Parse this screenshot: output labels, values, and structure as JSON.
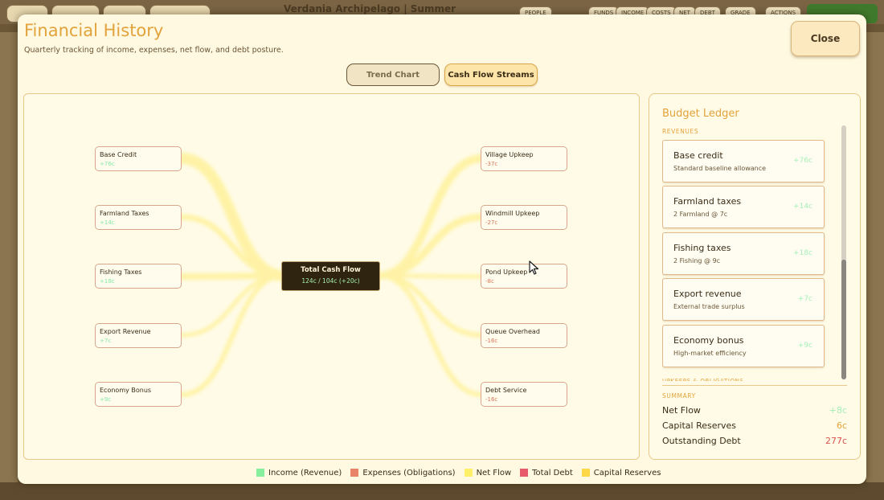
{
  "background": {
    "title": "Verdania Archipelago  |  Summer",
    "chips": [
      "PEOPLE",
      "FUNDS",
      "INCOME",
      "COSTS",
      "NET",
      "DEBT",
      "GRADE",
      "ACTIONS"
    ]
  },
  "modal": {
    "title": "Financial History",
    "subtitle": "Quarterly tracking of income, expenses, net flow, and debt posture.",
    "close_label": "Close"
  },
  "tabs": [
    {
      "label": "Trend Chart",
      "active": false
    },
    {
      "label": "Cash Flow Streams",
      "active": true
    }
  ],
  "streams": {
    "center": {
      "title": "Total Cash Flow",
      "value": "124c / 104c (+20c)"
    },
    "income": [
      {
        "name": "Base Credit",
        "value": "+76c"
      },
      {
        "name": "Farmland Taxes",
        "value": "+14c"
      },
      {
        "name": "Fishing Taxes",
        "value": "+18c"
      },
      {
        "name": "Export Revenue",
        "value": "+7c"
      },
      {
        "name": "Economy Bonus",
        "value": "+9c"
      }
    ],
    "expenses": [
      {
        "name": "Village Upkeep",
        "value": "-37c"
      },
      {
        "name": "Windmill Upkeep",
        "value": "-27c"
      },
      {
        "name": "Pond Upkeep",
        "value": "-8c"
      },
      {
        "name": "Queue Overhead",
        "value": "-16c"
      },
      {
        "name": "Debt Service",
        "value": "-16c"
      }
    ]
  },
  "legend": [
    {
      "label": "Income (Revenue)",
      "color": "#86ef9e"
    },
    {
      "label": "Expenses (Obligations)",
      "color": "#e8836a"
    },
    {
      "label": "Net Flow",
      "color": "#fff06a"
    },
    {
      "label": "Total Debt",
      "color": "#e85a6a"
    },
    {
      "label": "Capital Reserves",
      "color": "#ffd84a"
    }
  ],
  "ledger": {
    "title": "Budget Ledger",
    "revenues_label": "REVENUES",
    "obligations_label": "UPKEEPS & OBLIGATIONS",
    "items": [
      {
        "name": "Base credit",
        "desc": "Standard baseline allowance",
        "value": "+76c"
      },
      {
        "name": "Farmland taxes",
        "desc": "2 Farmland @ 7c",
        "value": "+14c"
      },
      {
        "name": "Fishing taxes",
        "desc": "2 Fishing @ 9c",
        "value": "+18c"
      },
      {
        "name": "Export revenue",
        "desc": "External trade surplus",
        "value": "+7c"
      },
      {
        "name": "Economy bonus",
        "desc": "High-market efficiency",
        "value": "+9c"
      }
    ],
    "summary_label": "SUMMARY",
    "summary": {
      "net_flow": {
        "label": "Net Flow",
        "value": "+8c",
        "color": "#a6efb8"
      },
      "capital_reserves": {
        "label": "Capital Reserves",
        "value": "6c",
        "color": "#e3a33c"
      },
      "outstanding_debt": {
        "label": "Outstanding Debt",
        "value": "277c",
        "color": "#d9534f"
      }
    }
  }
}
